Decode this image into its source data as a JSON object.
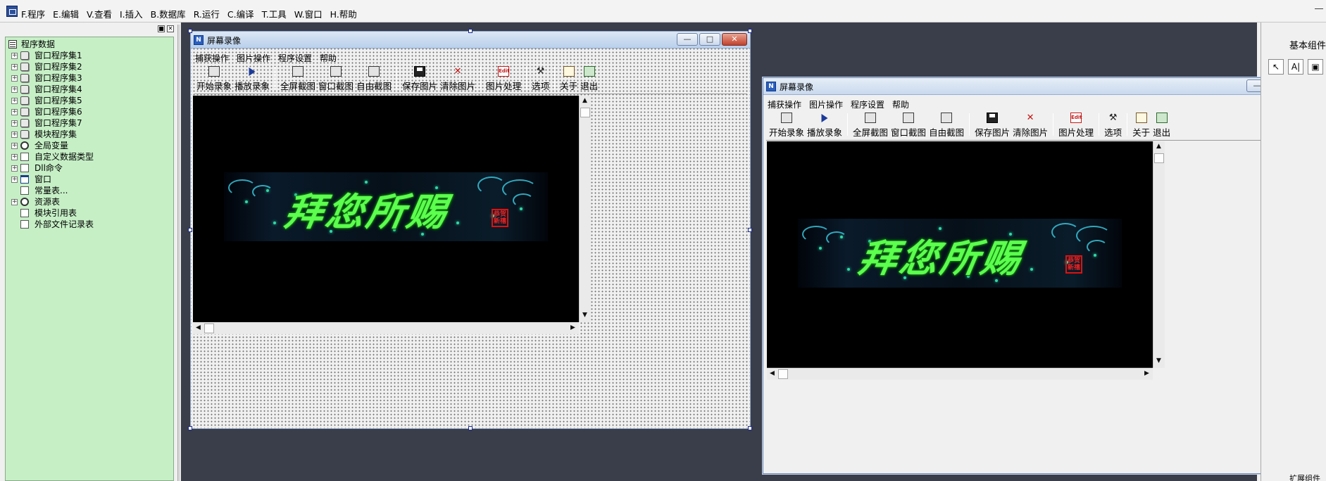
{
  "menubar": {
    "items": [
      "F.程序",
      "E.编辑",
      "V.查看",
      "I.插入",
      "B.数据库",
      "R.运行",
      "C.编译",
      "T.工具",
      "W.窗口",
      "H.帮助"
    ]
  },
  "left_panel": {
    "tree": [
      {
        "label": "程序数据",
        "icon": "database-icon",
        "expander": false,
        "level": 0
      },
      {
        "label": "窗口程序集1",
        "icon": "module-stack-icon",
        "expander": true,
        "level": 1
      },
      {
        "label": "窗口程序集2",
        "icon": "module-stack-icon",
        "expander": true,
        "level": 1
      },
      {
        "label": "窗口程序集3",
        "icon": "module-stack-icon",
        "expander": true,
        "level": 1
      },
      {
        "label": "窗口程序集4",
        "icon": "module-stack-icon",
        "expander": true,
        "level": 1
      },
      {
        "label": "窗口程序集5",
        "icon": "module-stack-icon",
        "expander": true,
        "level": 1
      },
      {
        "label": "窗口程序集6",
        "icon": "module-stack-icon",
        "expander": true,
        "level": 1
      },
      {
        "label": "窗口程序集7",
        "icon": "module-stack-icon",
        "expander": true,
        "level": 1
      },
      {
        "label": "模块程序集",
        "icon": "module-stack-icon",
        "expander": true,
        "level": 1
      },
      {
        "label": "全局变量",
        "icon": "globe-icon",
        "expander": true,
        "level": 1
      },
      {
        "label": "自定义数据类型",
        "icon": "datatype-icon",
        "expander": true,
        "level": 1
      },
      {
        "label": "Dll命令",
        "icon": "dll-icon",
        "expander": true,
        "level": 1
      },
      {
        "label": "窗口",
        "icon": "window-icon",
        "expander": true,
        "level": 1
      },
      {
        "label": "常量表...",
        "icon": "constant-icon",
        "expander": false,
        "level": 1
      },
      {
        "label": "资源表",
        "icon": "resource-icon",
        "expander": true,
        "level": 1
      },
      {
        "label": "模块引用表",
        "icon": "module-ref-icon",
        "expander": false,
        "level": 1
      },
      {
        "label": "外部文件记录表",
        "icon": "file-record-icon",
        "expander": false,
        "level": 1
      }
    ]
  },
  "design_window": {
    "title": "屏幕录像",
    "title_icon": "N",
    "menu": [
      "捕获操作",
      "图片操作",
      "程序设置",
      "帮助"
    ],
    "toolbar": [
      {
        "label": "开始录象",
        "icon": "record-icon"
      },
      {
        "label": "播放录象",
        "icon": "play-icon"
      },
      {
        "sep": true
      },
      {
        "label": "全屏截图",
        "icon": "fullscreen-capture-icon"
      },
      {
        "label": "窗口截图",
        "icon": "window-capture-icon"
      },
      {
        "label": "自由截图",
        "icon": "free-capture-icon"
      },
      {
        "sep": true
      },
      {
        "label": "保存图片",
        "icon": "save-icon"
      },
      {
        "label": "清除图片",
        "icon": "clear-icon"
      },
      {
        "sep": true
      },
      {
        "label": "图片处理",
        "icon": "edit-icon"
      },
      {
        "sep": true
      },
      {
        "label": "选项",
        "icon": "options-icon"
      },
      {
        "sep": true
      },
      {
        "label": "关于",
        "icon": "about-icon"
      },
      {
        "label": "退出",
        "icon": "exit-icon"
      }
    ],
    "caption_buttons": {
      "minimize": "—",
      "maximize": "□",
      "close": "✕"
    }
  },
  "preview_window": {
    "title": "屏幕录像",
    "title_icon": "N",
    "menu": [
      "捕获操作",
      "图片操作",
      "程序设置",
      "帮助"
    ],
    "caption_buttons": {
      "minimize": "—",
      "maximize": "□",
      "close": "✕"
    }
  },
  "banner": {
    "text": "拜您所赐",
    "seal": "恭贺新禧",
    "colors": {
      "glow": "#5cff4e",
      "seal": "#dd1111",
      "swirl": "#3ac2d8"
    }
  },
  "scroll": {
    "up": "▲",
    "down": "▼",
    "left": "◀",
    "right": "▶"
  },
  "right_panel": {
    "title": "基本组件",
    "tools": [
      {
        "glyph": "↖",
        "icon": "pointer-icon"
      },
      {
        "glyph": "A|",
        "icon": "label-tool-icon"
      },
      {
        "glyph": "▣",
        "icon": "picture-tool-icon"
      }
    ],
    "footer": "扩展组件"
  },
  "colors": {
    "workspace": "#3a3d4a",
    "tree_bg": "#c6efc6",
    "titlebar": "#c4d6ee"
  }
}
